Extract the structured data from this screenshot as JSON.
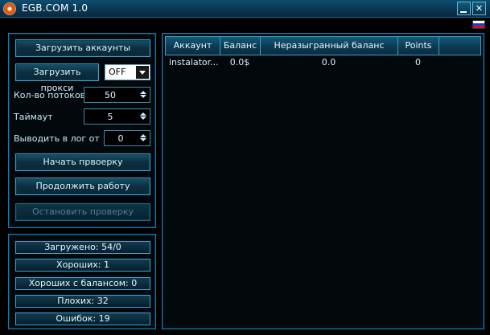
{
  "window": {
    "title": "EGB.COM 1.0"
  },
  "controls": {
    "load_accounts": "Загрузить аккаунты",
    "load_proxy": "Загрузить прокси",
    "proxy_mode": "OFF",
    "threads_label": "Кол-во потоков",
    "threads_value": "50",
    "timeout_label": "Таймаут",
    "timeout_value": "5",
    "log_from_label": "Выводить в лог от",
    "log_from_value": "0",
    "start_check": "Начать првоерку",
    "continue_work": "Продолжить работу",
    "stop_check": "Остановить проверку"
  },
  "stats": {
    "loaded": "Загружено: 54/0",
    "good": "Хороших: 1",
    "good_with_balance": "Хороших с балансом: 0",
    "bad": "Плохих: 32",
    "errors": "Ошибок: 19"
  },
  "table": {
    "columns": [
      "Аккаунт",
      "Баланс",
      "Неразыгранный баланс",
      "Points",
      ""
    ],
    "rows": [
      [
        "instalator...",
        "0.0$",
        "0.0",
        "0",
        ""
      ]
    ]
  },
  "colors": {
    "accent": "#0e7fb0",
    "button_border": "#3fa6ce",
    "background": "#000000"
  },
  "icons": {
    "app": "egb-logo-icon",
    "flag": "russian-flag-icon"
  }
}
